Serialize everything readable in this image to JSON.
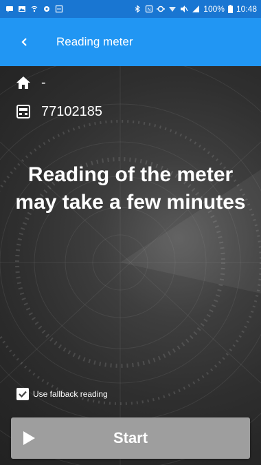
{
  "status_bar": {
    "battery": "100%",
    "time": "10:48",
    "icons": [
      "message-icon",
      "gallery-icon",
      "wifi-signal-icon",
      "location-icon",
      "image-icon",
      "bluetooth-icon",
      "nfc-icon",
      "sync-icon",
      "wifi-icon",
      "mute-icon",
      "signal-icon",
      "battery-icon"
    ]
  },
  "app_bar": {
    "title": "Reading meter",
    "back_icon": "chevron-left-icon"
  },
  "info": {
    "address": "-",
    "address_icon": "home-icon",
    "meter_number": "77102185",
    "meter_icon": "meter-icon"
  },
  "message": "Reading of the meter may take a few minutes",
  "fallback": {
    "label": "Use fallback reading",
    "checked": true
  },
  "start_button": {
    "label": "Start",
    "icon": "play-icon"
  },
  "colors": {
    "status_bar": "#1976d2",
    "app_bar": "#2196f3",
    "button": "#9e9e9e",
    "text": "#ffffff"
  }
}
